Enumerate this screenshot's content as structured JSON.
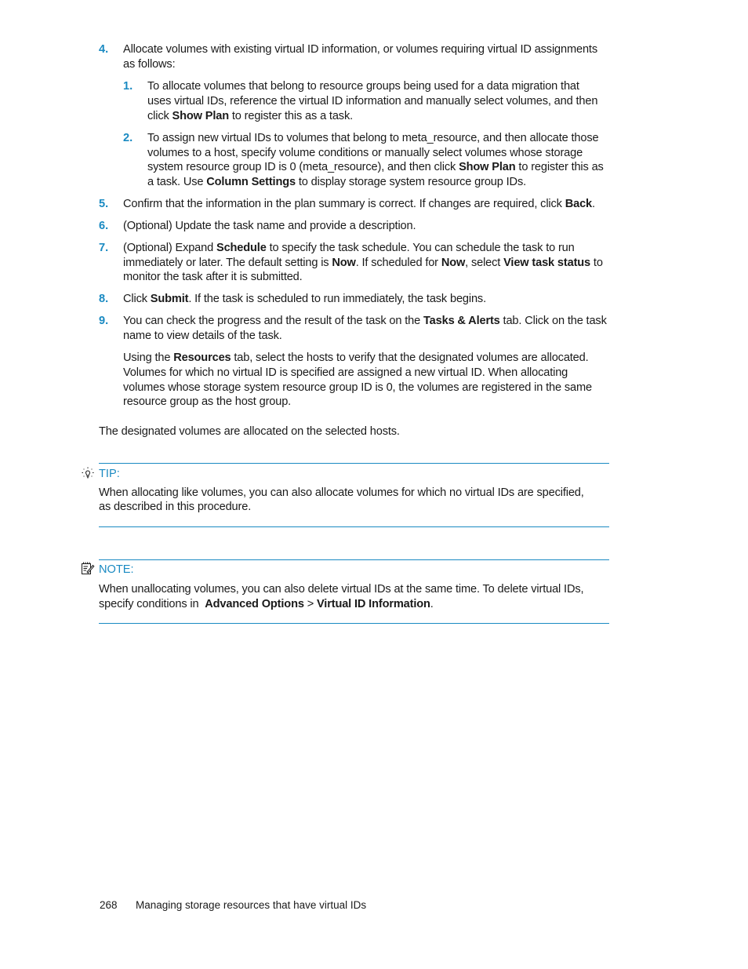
{
  "steps": [
    {
      "number": "4.",
      "lines": [
        "Allocate volumes with existing virtual ID information, or volumes requiring virtual ID assignments",
        "as follows:"
      ],
      "substeps": [
        {
          "number": "1.",
          "line1": "To allocate volumes that belong to resource groups being used for a data migration that",
          "line2": "uses virtual IDs, reference the virtual ID information and manually select volumes, and then",
          "line3_pre": "click ",
          "line3_bold": "Show Plan",
          "line3_post": " to register this as a task."
        },
        {
          "number": "2.",
          "line1": "To assign new virtual IDs to volumes that belong to meta_resource, and then allocate those",
          "line2": "volumes to a host, specify volume conditions or manually select volumes whose storage",
          "line3_pre": "system resource group ID is 0 (meta_resource), and then click ",
          "line3_bold": "Show Plan",
          "line3_post": " to register this as",
          "line4_pre": "a task. Use ",
          "line4_bold": "Column Settings",
          "line4_post": " to display storage system resource group IDs."
        }
      ]
    },
    {
      "number": "5.",
      "pre": "Confirm that the information in the plan summary is correct. If changes are required, click ",
      "bold": "Back",
      "post": "."
    },
    {
      "number": "6.",
      "text": "(Optional) Update the task name and provide a description."
    },
    {
      "number": "7.",
      "l1_pre": "(Optional) Expand ",
      "l1_bold": "Schedule",
      "l1_post": " to specify the task schedule. You can schedule the task to run",
      "l2_pre": "immediately or later. The default setting is ",
      "l2_bold1": "Now",
      "l2_mid1": ". If scheduled for ",
      "l2_bold2": "Now",
      "l2_mid2": ", select ",
      "l2_bold3": "View task status",
      "l2_post": " to",
      "l3": "monitor the task after it is submitted."
    },
    {
      "number": "8.",
      "pre": "Click ",
      "bold": "Submit",
      "post": ". If the task is scheduled to run immediately, the task begins."
    },
    {
      "number": "9.",
      "l1_pre": "You can check the progress and the result of the task on the ",
      "l1_bold": "Tasks & Alerts",
      "l1_post": " tab. Click on the task",
      "l2": "name to view details of the task.",
      "p_l1_pre": "Using the ",
      "p_l1_bold": "Resources",
      "p_l1_post": " tab, select the hosts to verify that the designated volumes are allocated.",
      "p_l2": "Volumes for which no virtual ID is specified are assigned a new virtual ID. When allocating",
      "p_l3": "volumes whose storage system resource group ID is 0, the volumes are registered in the same",
      "p_l4": "resource group as the host group."
    }
  ],
  "result": "The designated volumes are allocated on the selected hosts.",
  "tip": {
    "icon": "lightbulb-icon",
    "label": "TIP:",
    "l1": "When allocating like volumes, you can also allocate volumes for which no virtual IDs are specified,",
    "l2": "as described in this procedure."
  },
  "note": {
    "icon": "note-pencil-icon",
    "label": "NOTE:",
    "l1": "When unallocating volumes, you can also delete virtual IDs at the same time. To delete virtual IDs,",
    "l2_pre": "specify conditions in  ",
    "l2_bold1": "Advanced Options",
    "l2_mid": " > ",
    "l2_bold2": "Virtual ID Information",
    "l2_post": "."
  },
  "footer": {
    "page_number": "268",
    "section_title": "Managing storage resources that have virtual IDs"
  },
  "colors": {
    "accent": "#1a8ac2",
    "text": "#1a1a1a"
  }
}
